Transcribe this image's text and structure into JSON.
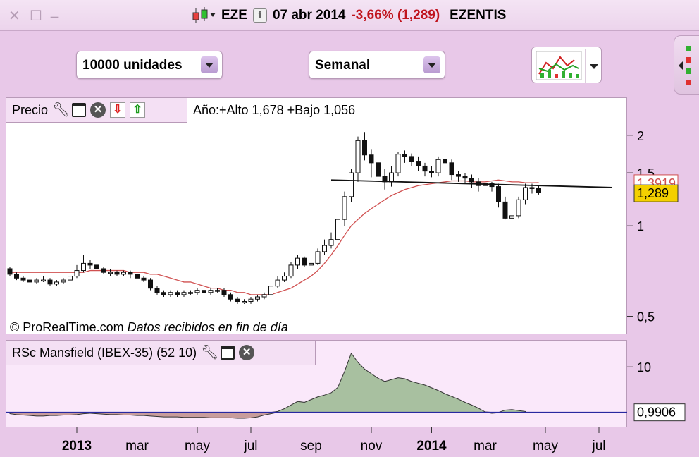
{
  "window": {
    "close_glyph": "✕",
    "restore_glyph": "☐",
    "minimize_glyph": "_"
  },
  "title": {
    "ticker": "EZE",
    "info_glyph": "i",
    "date": "07 abr 2014",
    "change": "-3,66% (1,289)",
    "name": "EZENTIS"
  },
  "toolbar": {
    "units_select": "10000 unidades",
    "period_select": "Semanal"
  },
  "price_panel": {
    "title": "Precio",
    "stats": "Año:+Alto 1,678 +Bajo 1,056",
    "copyright": "© ProRealTime.com",
    "data_note": "Datos recibidos en fin de día"
  },
  "rsc_panel": {
    "title": "RSc Mansfield (IBEX-35) (52 10)"
  },
  "colors": {
    "ma_line": "#d05050",
    "current_label_bg": "#f4d000",
    "rsc_pos_fill": "#a8c0a0",
    "rsc_neg_fill": "#c89c9c",
    "rsc_baseline": "#2828a0",
    "change_red": "#c0141e"
  },
  "chart_data": [
    {
      "type": "candlestick",
      "scale": "log",
      "y_ticks": [
        "2",
        "1,5",
        "1",
        "0,5"
      ],
      "y_tick_values": [
        2,
        1.5,
        1,
        0.5
      ],
      "ylim": [
        0.45,
        2.25
      ],
      "price_tags": [
        {
          "label": "1,3919",
          "value": 1.3919,
          "series": "ma"
        },
        {
          "label": "1,289",
          "value": 1.289,
          "series": "last"
        }
      ],
      "x_ticks": [
        {
          "label": "2013",
          "bold": true,
          "week": 10
        },
        {
          "label": "mar",
          "week": 19
        },
        {
          "label": "may",
          "week": 28
        },
        {
          "label": "jul",
          "week": 36
        },
        {
          "label": "sep",
          "week": 45
        },
        {
          "label": "nov",
          "week": 54
        },
        {
          "label": "2014",
          "bold": true,
          "week": 63
        },
        {
          "label": "mar",
          "week": 71
        },
        {
          "label": "may",
          "week": 80
        },
        {
          "label": "jul",
          "week": 88
        }
      ],
      "candles": [
        [
          0.72,
          0.69,
          0.73,
          0.68
        ],
        [
          0.69,
          0.67,
          0.7,
          0.66
        ],
        [
          0.67,
          0.66,
          0.68,
          0.65
        ],
        [
          0.66,
          0.65,
          0.67,
          0.64
        ],
        [
          0.65,
          0.66,
          0.67,
          0.64
        ],
        [
          0.66,
          0.66,
          0.68,
          0.65
        ],
        [
          0.66,
          0.64,
          0.67,
          0.63
        ],
        [
          0.64,
          0.65,
          0.66,
          0.63
        ],
        [
          0.65,
          0.66,
          0.67,
          0.64
        ],
        [
          0.66,
          0.68,
          0.69,
          0.65
        ],
        [
          0.68,
          0.71,
          0.74,
          0.67
        ],
        [
          0.71,
          0.75,
          0.8,
          0.7
        ],
        [
          0.75,
          0.74,
          0.77,
          0.72
        ],
        [
          0.74,
          0.72,
          0.75,
          0.71
        ],
        [
          0.72,
          0.7,
          0.73,
          0.69
        ],
        [
          0.7,
          0.7,
          0.72,
          0.68
        ],
        [
          0.7,
          0.69,
          0.71,
          0.68
        ],
        [
          0.69,
          0.7,
          0.71,
          0.68
        ],
        [
          0.7,
          0.69,
          0.71,
          0.67
        ],
        [
          0.69,
          0.67,
          0.7,
          0.66
        ],
        [
          0.67,
          0.66,
          0.68,
          0.65
        ],
        [
          0.66,
          0.62,
          0.67,
          0.61
        ],
        [
          0.62,
          0.6,
          0.63,
          0.59
        ],
        [
          0.6,
          0.59,
          0.61,
          0.58
        ],
        [
          0.59,
          0.6,
          0.61,
          0.58
        ],
        [
          0.6,
          0.59,
          0.61,
          0.58
        ],
        [
          0.59,
          0.6,
          0.61,
          0.58
        ],
        [
          0.6,
          0.6,
          0.61,
          0.59
        ],
        [
          0.6,
          0.61,
          0.62,
          0.59
        ],
        [
          0.61,
          0.6,
          0.62,
          0.59
        ],
        [
          0.6,
          0.61,
          0.62,
          0.59
        ],
        [
          0.61,
          0.61,
          0.62,
          0.6
        ],
        [
          0.61,
          0.59,
          0.62,
          0.58
        ],
        [
          0.59,
          0.57,
          0.6,
          0.56
        ],
        [
          0.57,
          0.56,
          0.58,
          0.55
        ],
        [
          0.56,
          0.56,
          0.57,
          0.55
        ],
        [
          0.56,
          0.57,
          0.58,
          0.55
        ],
        [
          0.57,
          0.58,
          0.59,
          0.56
        ],
        [
          0.58,
          0.59,
          0.6,
          0.57
        ],
        [
          0.59,
          0.63,
          0.65,
          0.58
        ],
        [
          0.63,
          0.66,
          0.68,
          0.62
        ],
        [
          0.66,
          0.68,
          0.7,
          0.65
        ],
        [
          0.68,
          0.74,
          0.76,
          0.67
        ],
        [
          0.74,
          0.78,
          0.8,
          0.72
        ],
        [
          0.78,
          0.74,
          0.79,
          0.73
        ],
        [
          0.74,
          0.75,
          0.77,
          0.73
        ],
        [
          0.75,
          0.82,
          0.84,
          0.74
        ],
        [
          0.82,
          0.86,
          0.9,
          0.8
        ],
        [
          0.86,
          0.9,
          0.95,
          0.84
        ],
        [
          0.9,
          1.05,
          1.1,
          0.88
        ],
        [
          1.05,
          1.25,
          1.3,
          1.0
        ],
        [
          1.25,
          1.5,
          1.55,
          1.2
        ],
        [
          1.5,
          1.92,
          1.98,
          1.4
        ],
        [
          1.92,
          1.72,
          2.05,
          1.65
        ],
        [
          1.72,
          1.62,
          1.8,
          1.45
        ],
        [
          1.62,
          1.46,
          1.7,
          1.4
        ],
        [
          1.46,
          1.4,
          1.55,
          1.32
        ],
        [
          1.4,
          1.5,
          1.58,
          1.35
        ],
        [
          1.5,
          1.73,
          1.76,
          1.46
        ],
        [
          1.73,
          1.7,
          1.78,
          1.62
        ],
        [
          1.7,
          1.64,
          1.74,
          1.58
        ],
        [
          1.64,
          1.58,
          1.7,
          1.52
        ],
        [
          1.58,
          1.52,
          1.62,
          1.46
        ],
        [
          1.52,
          1.5,
          1.58,
          1.45
        ],
        [
          1.5,
          1.66,
          1.7,
          1.46
        ],
        [
          1.66,
          1.62,
          1.72,
          1.5
        ],
        [
          1.62,
          1.48,
          1.66,
          1.42
        ],
        [
          1.48,
          1.46,
          1.52,
          1.4
        ],
        [
          1.46,
          1.44,
          1.5,
          1.38
        ],
        [
          1.44,
          1.4,
          1.48,
          1.34
        ],
        [
          1.4,
          1.36,
          1.44,
          1.3
        ],
        [
          1.36,
          1.38,
          1.42,
          1.32
        ],
        [
          1.38,
          1.35,
          1.4,
          1.3
        ],
        [
          1.35,
          1.2,
          1.38,
          1.15
        ],
        [
          1.2,
          1.06,
          1.25,
          1.05
        ],
        [
          1.06,
          1.08,
          1.12,
          1.04
        ],
        [
          1.08,
          1.22,
          1.25,
          1.06
        ],
        [
          1.22,
          1.34,
          1.38,
          1.18
        ],
        [
          1.34,
          1.33,
          1.38,
          1.28
        ],
        [
          1.33,
          1.289,
          1.36,
          1.27
        ]
      ],
      "ma": [
        0.7,
        0.7,
        0.7,
        0.7,
        0.7,
        0.7,
        0.7,
        0.7,
        0.7,
        0.7,
        0.7,
        0.7,
        0.71,
        0.71,
        0.71,
        0.71,
        0.71,
        0.71,
        0.7,
        0.7,
        0.7,
        0.69,
        0.69,
        0.68,
        0.67,
        0.66,
        0.65,
        0.65,
        0.64,
        0.63,
        0.62,
        0.62,
        0.61,
        0.61,
        0.6,
        0.6,
        0.59,
        0.59,
        0.59,
        0.59,
        0.6,
        0.61,
        0.62,
        0.64,
        0.66,
        0.68,
        0.71,
        0.75,
        0.8,
        0.86,
        0.93,
        1.0,
        1.05,
        1.1,
        1.14,
        1.18,
        1.22,
        1.26,
        1.29,
        1.32,
        1.34,
        1.36,
        1.37,
        1.38,
        1.39,
        1.4,
        1.41,
        1.41,
        1.41,
        1.4,
        1.4,
        1.4,
        1.41,
        1.42,
        1.41,
        1.4,
        1.4,
        1.39,
        1.39,
        1.3919
      ],
      "trendline": {
        "from": [
          48,
          1.42
        ],
        "to": [
          90,
          1.34
        ]
      }
    },
    {
      "type": "area",
      "name": "RSc Mansfield (IBEX-35) (52 10)",
      "y_ticks": [
        "10"
      ],
      "y_tick_values": [
        10
      ],
      "baseline": 0,
      "ylim": [
        -3,
        15
      ],
      "price_tags": [
        {
          "label": "0,9906",
          "value": 0.9906
        }
      ],
      "values": [
        -0.3,
        -0.5,
        -0.6,
        -0.7,
        -0.8,
        -0.8,
        -0.7,
        -0.7,
        -0.6,
        -0.6,
        -0.5,
        -0.3,
        -0.2,
        -0.3,
        -0.4,
        -0.5,
        -0.5,
        -0.6,
        -0.6,
        -0.7,
        -0.7,
        -0.8,
        -0.9,
        -1.0,
        -1.0,
        -1.0,
        -1.1,
        -1.1,
        -1.1,
        -1.1,
        -1.2,
        -1.2,
        -1.2,
        -1.2,
        -1.3,
        -1.3,
        -1.2,
        -1.0,
        -0.6,
        -0.3,
        0.2,
        0.8,
        1.6,
        2.4,
        2.2,
        2.8,
        3.4,
        3.8,
        4.3,
        5.5,
        9,
        13,
        11,
        9.5,
        8.5,
        7.5,
        6.8,
        7.2,
        7.6,
        7.4,
        6.8,
        6.4,
        6.0,
        5.4,
        4.8,
        4.1,
        3.5,
        2.9,
        2.2,
        1.6,
        0.9,
        0.1,
        -0.2,
        -0.1,
        0.5,
        0.6,
        0.4,
        0.2
      ]
    }
  ]
}
